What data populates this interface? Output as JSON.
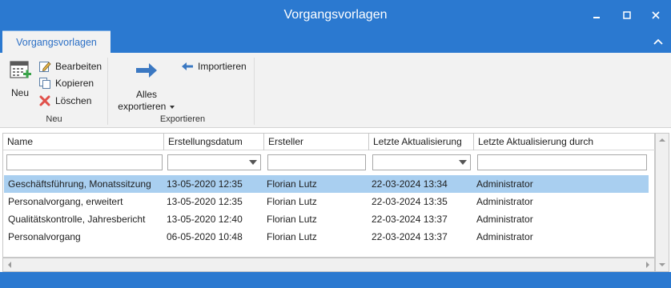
{
  "window": {
    "title": "Vorgangsvorlagen"
  },
  "tabs": [
    {
      "label": "Vorgangsvorlagen",
      "active": true
    }
  ],
  "ribbon": {
    "groups": [
      {
        "label": "Neu",
        "big_button": {
          "label": "Neu",
          "icon": "calendar-add-icon"
        },
        "small_buttons": [
          {
            "label": "Bearbeiten",
            "icon": "edit-icon"
          },
          {
            "label": "Kopieren",
            "icon": "copy-icon"
          },
          {
            "label": "Löschen",
            "icon": "delete-icon"
          }
        ]
      },
      {
        "label": "Exportieren",
        "big_button": {
          "label_line1": "Alles",
          "label_line2": "exportieren",
          "icon": "arrow-right-icon"
        },
        "small_buttons": [
          {
            "label": "Importieren",
            "icon": "arrow-left-icon"
          }
        ]
      }
    ]
  },
  "grid": {
    "columns": [
      "Name",
      "Erstellungsdatum",
      "Ersteller",
      "Letzte Aktualisierung",
      "Letzte Aktualisierung durch"
    ],
    "rows": [
      [
        "Geschäftsführung, Monatssitzung",
        "13-05-2020 12:35",
        "Florian Lutz",
        "22-03-2024 13:34",
        "Administrator"
      ],
      [
        "Personalvorgang, erweitert",
        "13-05-2020 12:35",
        "Florian Lutz",
        "22-03-2024 13:35",
        "Administrator"
      ],
      [
        "Qualitätskontrolle, Jahresbericht",
        "13-05-2020 12:40",
        "Florian Lutz",
        "22-03-2024 13:37",
        "Administrator"
      ],
      [
        "Personalvorgang",
        "06-05-2020 10:48",
        "Florian Lutz",
        "22-03-2024 13:37",
        "Administrator"
      ]
    ],
    "selected_row": 0
  },
  "colors": {
    "accent": "#2b79d0",
    "selection": "#a9cff0",
    "ribbon_bg": "#f2f2f2"
  }
}
